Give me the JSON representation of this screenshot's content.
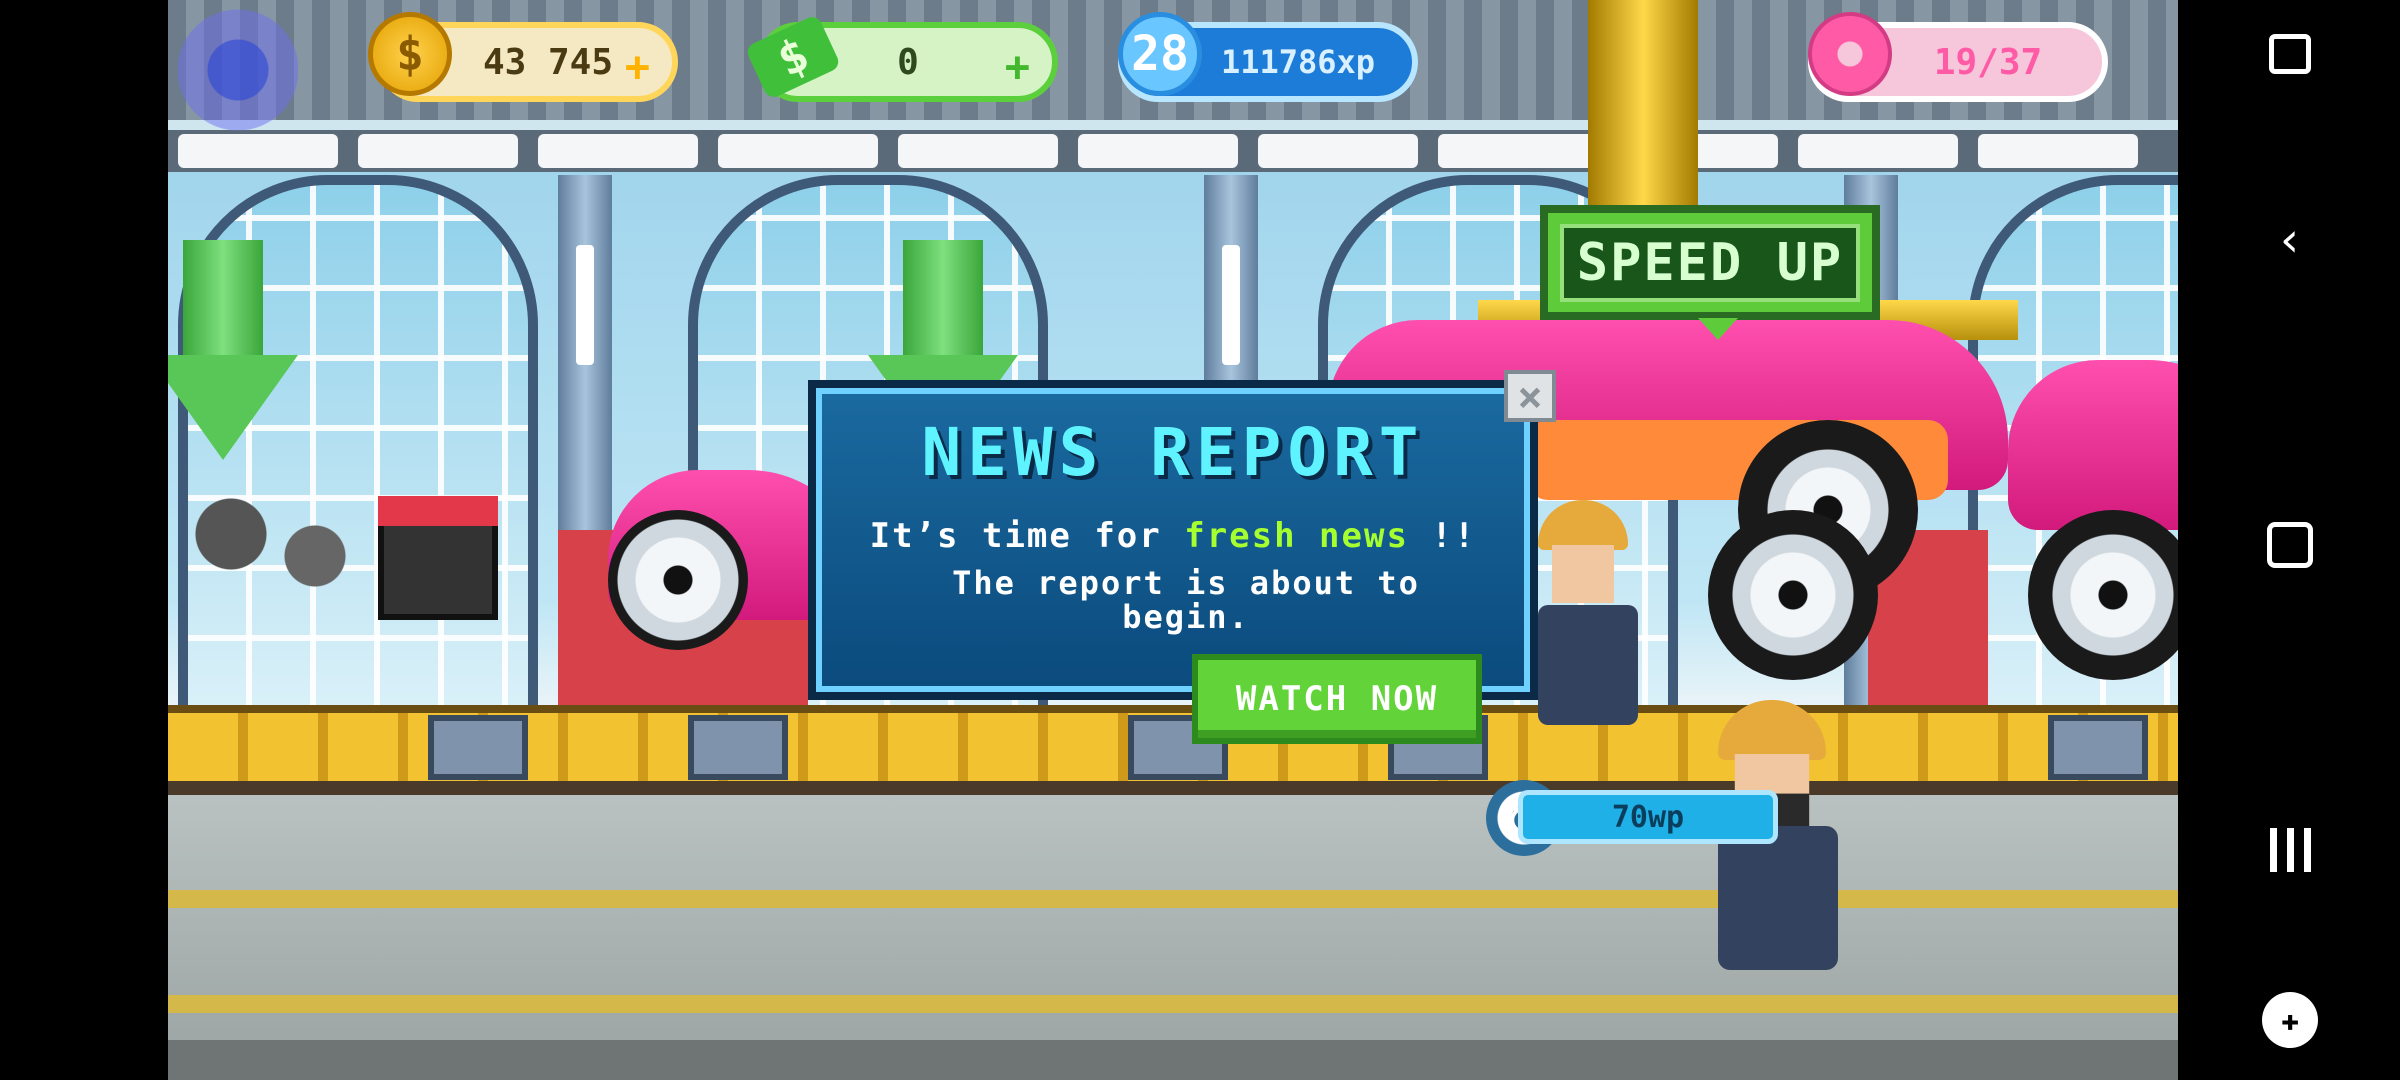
{
  "hud": {
    "coins": "43 745",
    "coins_plus": "+",
    "cash": "0",
    "cash_plus": "+",
    "level": "28",
    "xp": "111786xp",
    "donuts": "19/37"
  },
  "speed_up_label": "SPEED UP",
  "work_progress": "70wp",
  "modal": {
    "title": "NEWS REPORT",
    "line1_prefix": "It’s time for ",
    "line1_highlight": "fresh news",
    "line1_suffix": " !!",
    "line2": "The report is about to begin.",
    "close": "×",
    "button": "WATCH NOW"
  },
  "icons": {
    "coin": "$",
    "cash": "$",
    "back": "‹",
    "game": "✚"
  },
  "colors": {
    "accent_green": "#63d33a",
    "news_title": "#5ff3ff",
    "highlight": "#a6ff2e",
    "donut_pink": "#ff5aa6"
  }
}
